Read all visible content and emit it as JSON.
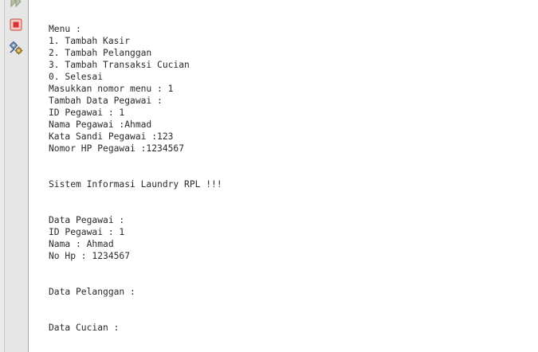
{
  "toolbar": {
    "buttons": [
      {
        "name": "rerun",
        "icon": "rerun-icon",
        "color": "#9aa48a"
      },
      {
        "name": "stop",
        "icon": "stop-icon",
        "color": "#d9312f"
      },
      {
        "name": "settings",
        "icon": "gear-settings-icon",
        "color": "#3a5f8a"
      }
    ]
  },
  "output": {
    "lines": [
      "Menu :",
      "1. Tambah Kasir",
      "2. Tambah Pelanggan",
      "3. Tambah Transaksi Cucian",
      "0. Selesai",
      "Masukkan nomor menu : 1",
      "Tambah Data Pegawai :",
      "ID Pegawai : 1",
      "Nama Pegawai :Ahmad",
      "Kata Sandi Pegawai :123",
      "Nomor HP Pegawai :1234567",
      "",
      "",
      "Sistem Informasi Laundry RPL !!!",
      "",
      "",
      "Data Pegawai :",
      "ID Pegawai : 1",
      "Nama : Ahmad",
      "No Hp : 1234567",
      "",
      "",
      "Data Pelanggan :",
      "",
      "",
      "Data Cucian :"
    ]
  }
}
